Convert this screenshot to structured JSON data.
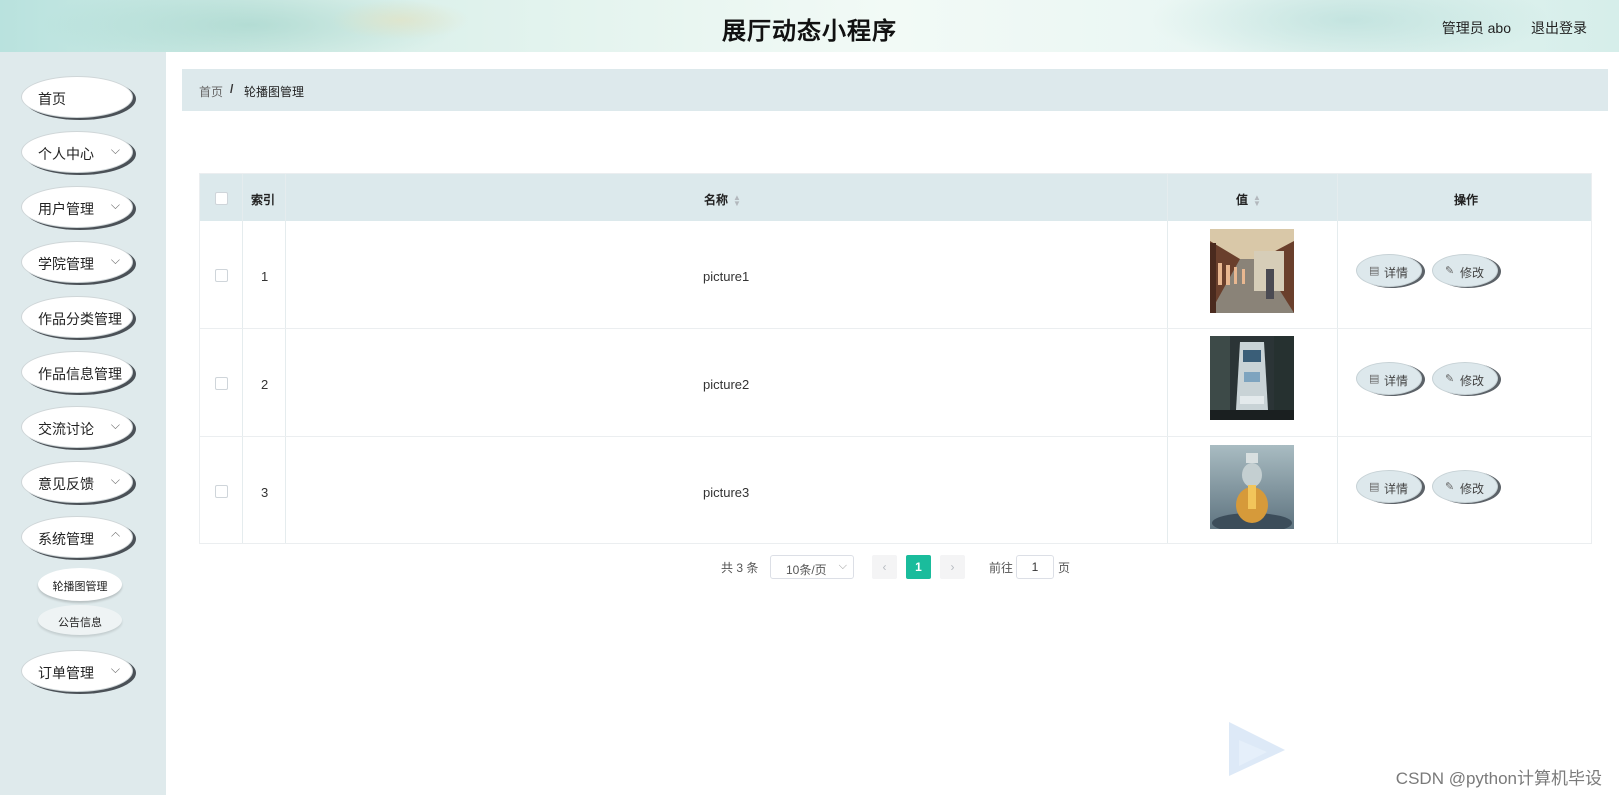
{
  "header": {
    "title": "展厅动态小程序",
    "user": "管理员 abo",
    "logout": "退出登录"
  },
  "sidebar": {
    "items": [
      {
        "label": "首页",
        "has_arrow": false
      },
      {
        "label": "个人中心",
        "has_arrow": true
      },
      {
        "label": "用户管理",
        "has_arrow": true
      },
      {
        "label": "学院管理",
        "has_arrow": true
      },
      {
        "label": "作品分类管理",
        "has_arrow": false
      },
      {
        "label": "作品信息管理",
        "has_arrow": false
      },
      {
        "label": "交流讨论",
        "has_arrow": true
      },
      {
        "label": "意见反馈",
        "has_arrow": true
      },
      {
        "label": "系统管理",
        "has_arrow": true
      },
      {
        "label": "订单管理",
        "has_arrow": true
      }
    ],
    "sub_items": [
      "轮播图管理",
      "公告信息"
    ],
    "chevron": "⌵"
  },
  "breadcrumb": {
    "home": "首页",
    "separator": "/",
    "current": "轮播图管理"
  },
  "table": {
    "headers": {
      "index": "索引",
      "name": "名称",
      "value": "值",
      "action": "操作"
    },
    "rows": [
      {
        "index": "1",
        "name": "picture1",
        "image": "corridor"
      },
      {
        "index": "2",
        "name": "picture2",
        "image": "train"
      },
      {
        "index": "3",
        "name": "picture3",
        "image": "figure"
      }
    ],
    "detail_label": "详情",
    "edit_label": "修改"
  },
  "pagination": {
    "total": "共 3 条",
    "page_size": "10条/页",
    "current_page": "1",
    "goto_label": "前往",
    "goto_value": "1",
    "page_unit": "页",
    "prev": "‹",
    "next": "›"
  },
  "watermark": "CSDN @python计算机毕设",
  "colors": {
    "accent": "#1abc9c",
    "sidebar_bg": "#dfeaec",
    "table_header_bg": "#dce9ec"
  }
}
